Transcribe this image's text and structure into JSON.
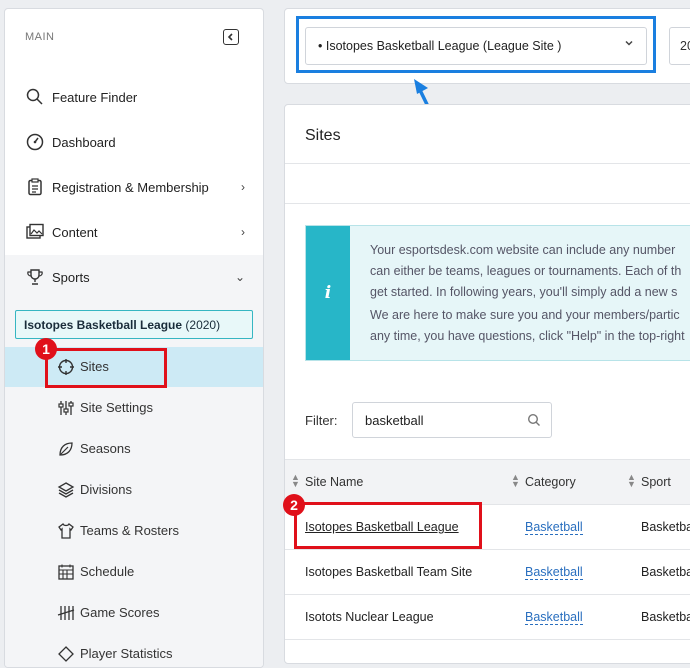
{
  "sidebar": {
    "section_label": "MAIN",
    "items": [
      {
        "label": "Feature Finder"
      },
      {
        "label": "Dashboard"
      },
      {
        "label": "Registration & Membership",
        "chevron": "›"
      },
      {
        "label": "Content",
        "chevron": "›"
      },
      {
        "label": "Sports",
        "chevron": "⌄"
      }
    ],
    "league": {
      "name": "Isotopes Basketball League",
      "year": "(2020)"
    },
    "sub_items": [
      {
        "label": "Sites"
      },
      {
        "label": "Site Settings"
      },
      {
        "label": "Seasons"
      },
      {
        "label": "Divisions"
      },
      {
        "label": "Teams & Rosters"
      },
      {
        "label": "Schedule"
      },
      {
        "label": "Game Scores"
      },
      {
        "label": "Player Statistics"
      }
    ]
  },
  "topbar": {
    "site_select_value": "• Isotopes Basketball League (League Site )",
    "year_value": "20"
  },
  "annotations": {
    "badge1": "1",
    "badge2": "2",
    "annotation_color": "#e0101a",
    "arrow_color": "#1a7fe0"
  },
  "main": {
    "title": "Sites",
    "info_lines": [
      "Your esportsdesk.com website can include any number",
      "can either be teams, leagues or tournaments. Each of th",
      "get started. In following years, you'll simply add a new s",
      "We are here to make sure you and your members/partic",
      "any time, you have questions, click \"Help\" in the top-right"
    ],
    "filter_label": "Filter:",
    "filter_value": "basketball",
    "columns": [
      "Site Name",
      "Category",
      "Sport"
    ],
    "rows": [
      {
        "name": "Isotopes Basketball League",
        "category": "Basketball",
        "sport": "Basketba"
      },
      {
        "name": "Isotopes Basketball Team Site",
        "category": "Basketball",
        "sport": "Basketba"
      },
      {
        "name": "Isotots Nuclear League",
        "category": "Basketball",
        "sport": "Basketba"
      }
    ]
  }
}
